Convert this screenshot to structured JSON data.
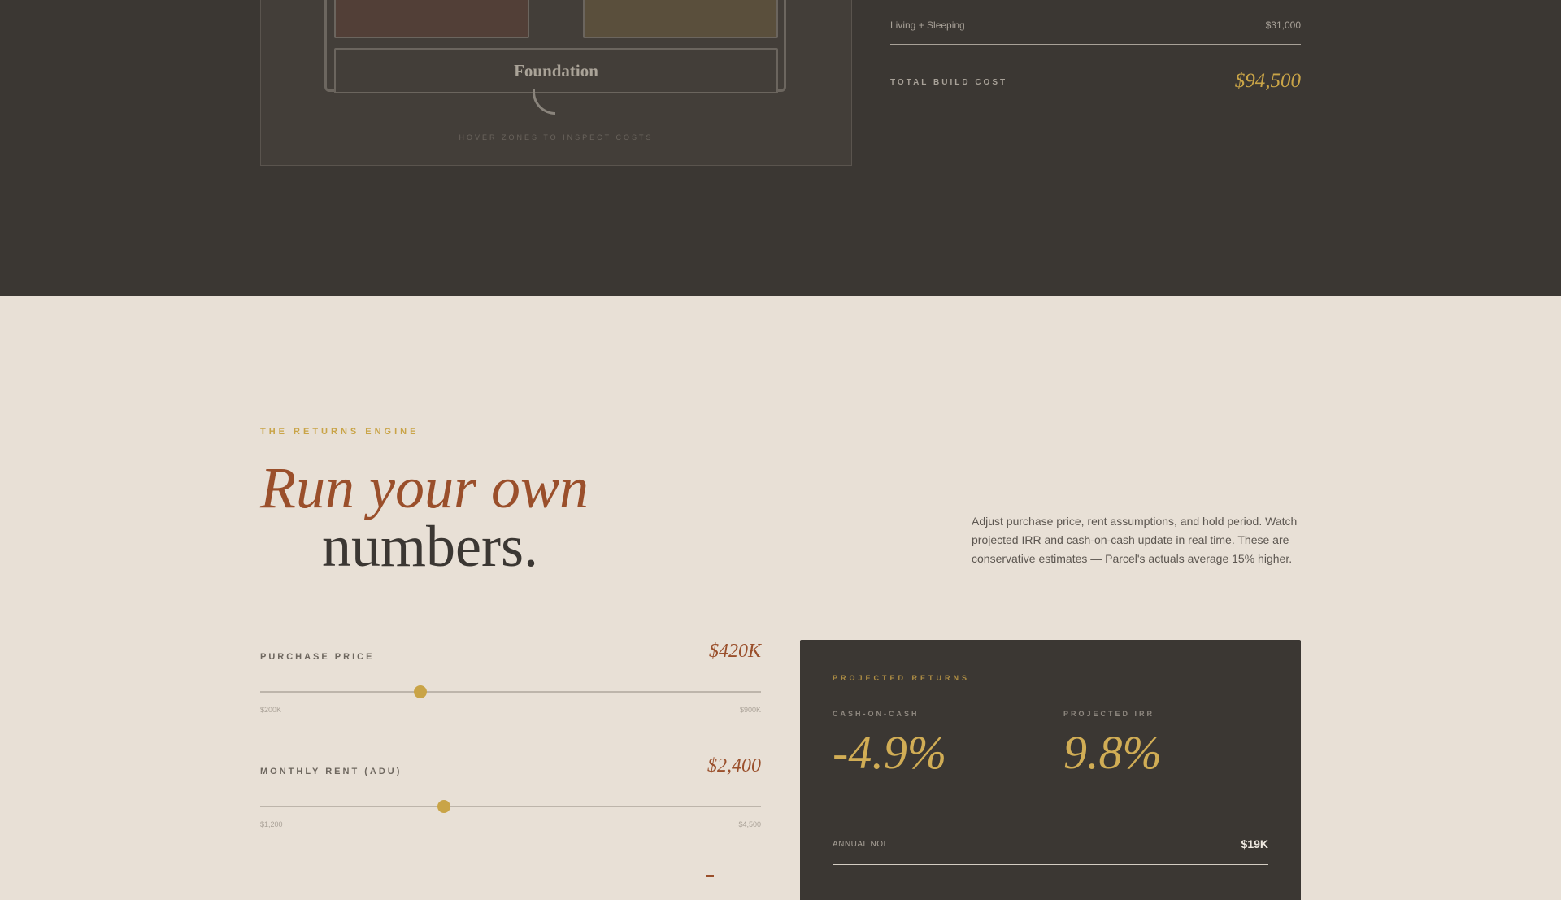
{
  "build_costs": {
    "zone_labels": {
      "foundation": "Foundation"
    },
    "hover_hint": "HOVER ZONES TO INSPECT COSTS",
    "rows": [
      {
        "label": "Living + Sleeping",
        "value": "$31,000"
      }
    ],
    "total_label": "TOTAL BUILD COST",
    "total_value": "$94,500"
  },
  "returns": {
    "eyebrow": "THE RETURNS ENGINE",
    "headline_italic": "Run your own",
    "headline_plain": "numbers.",
    "intro": "Adjust purchase price, rent assumptions, and hold period. Watch projected IRR and cash-on-cash update in real time. These are conservative estimates — Parcel's actuals average 15% higher.",
    "sliders": [
      {
        "label": "PURCHASE PRICE",
        "value": "$420K",
        "min": "$200K",
        "max": "$900K",
        "fraction": 0.32
      },
      {
        "label": "MONTHLY RENT (ADU)",
        "value": "$2,400",
        "min": "$1,200",
        "max": "$4,500",
        "fraction": 0.367
      }
    ]
  },
  "projected": {
    "title": "PROJECTED RETURNS",
    "cash_on_cash_label": "CASH-ON-CASH",
    "cash_on_cash_value": "-4.9%",
    "irr_label": "PROJECTED IRR",
    "irr_value": "9.8%",
    "noi_label": "ANNUAL NOI",
    "noi_value": "$19K"
  },
  "colors": {
    "dark_bg": "#3b3733",
    "light_bg": "#e8e0d6",
    "accent_gold": "#c9a447",
    "accent_rust": "#9a4f2b"
  }
}
